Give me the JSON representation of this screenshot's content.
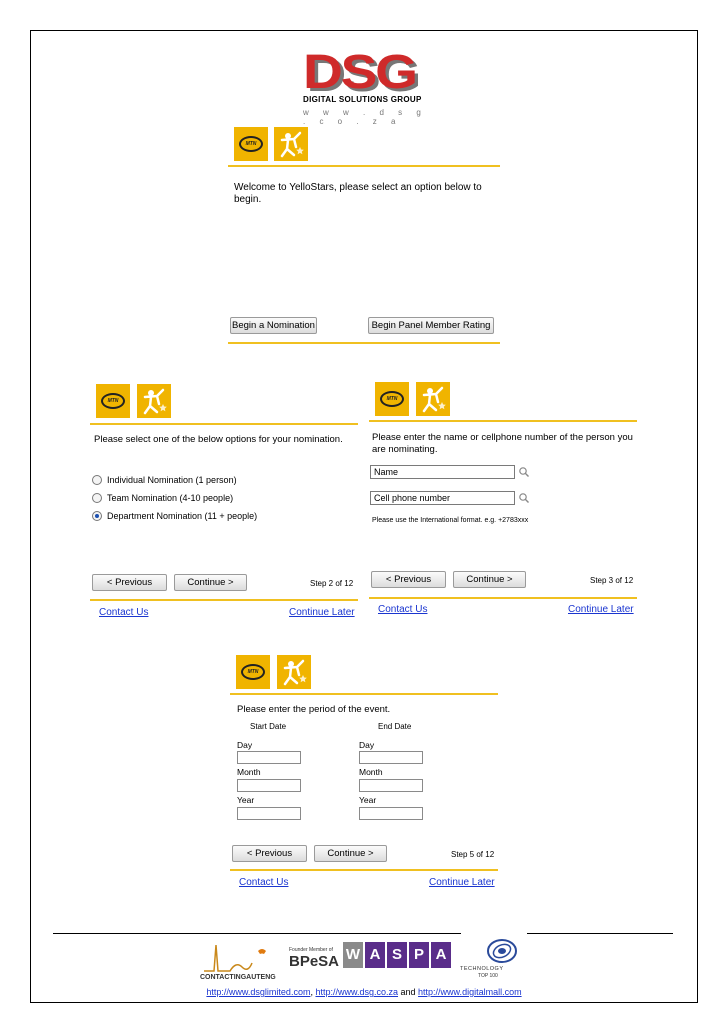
{
  "header": {
    "logo_letters": "DSG",
    "logo_subtitle": "DIGITAL SOLUTIONS GROUP",
    "logo_url": "w w w . d s g . c o . z a"
  },
  "brand": {
    "mtn": "MTN",
    "accent": "#f0b400",
    "line": "#f0c020",
    "link": "#1a35d0"
  },
  "panel1": {
    "welcome": "Welcome to YelloStars, please select an option below to begin.",
    "begin_nomination": "Begin a Nomination",
    "begin_panel": "Begin Panel Member Rating"
  },
  "panel2": {
    "prompt": "Please select one of the below options for your nomination.",
    "options": [
      "Individual Nomination (1 person)",
      "Team Nomination (4-10 people)",
      "Department Nomination (11 + people)"
    ],
    "selected_index": 2,
    "previous": "< Previous",
    "continue": "Continue  >",
    "step": "Step 2 of 12",
    "contact": "Contact Us",
    "later": "Continue Later"
  },
  "panel3": {
    "prompt": "Please enter the name or cellphone number of the person you are nominating.",
    "name_value": "Name",
    "cell_value": "Cell phone number",
    "hint": "Please use the International format.  e.g. +2783xxx",
    "previous": "< Previous",
    "continue": "Continue  >",
    "step": "Step 3 of 12",
    "contact": "Contact Us",
    "later": "Continue Later"
  },
  "panel4": {
    "prompt": "Please enter the period of the event.",
    "start_date": "Start Date",
    "end_date": "End Date",
    "day": "Day",
    "month": "Month",
    "year": "Year",
    "previous": "< Previous",
    "continue": "Continue  >",
    "step": "Step 5 of 12",
    "contact": "Contact Us",
    "later": "Continue Later"
  },
  "footer": {
    "contact_logo": "CONTACTINGAUTENG",
    "bpesa_small": "Founder Member of",
    "bpesa": "BPeSA",
    "waspa": [
      "W",
      "A",
      "S",
      "P",
      "A"
    ],
    "tech_top": "TECHNOLOGY",
    "tech_bottom": "TOP 100",
    "link1": "http://www.dsglimited.com",
    "sep1": ", ",
    "link2": "http://www.dsg.co.za",
    "sep2": " and ",
    "link3": "http://www.digitalmall.com"
  }
}
